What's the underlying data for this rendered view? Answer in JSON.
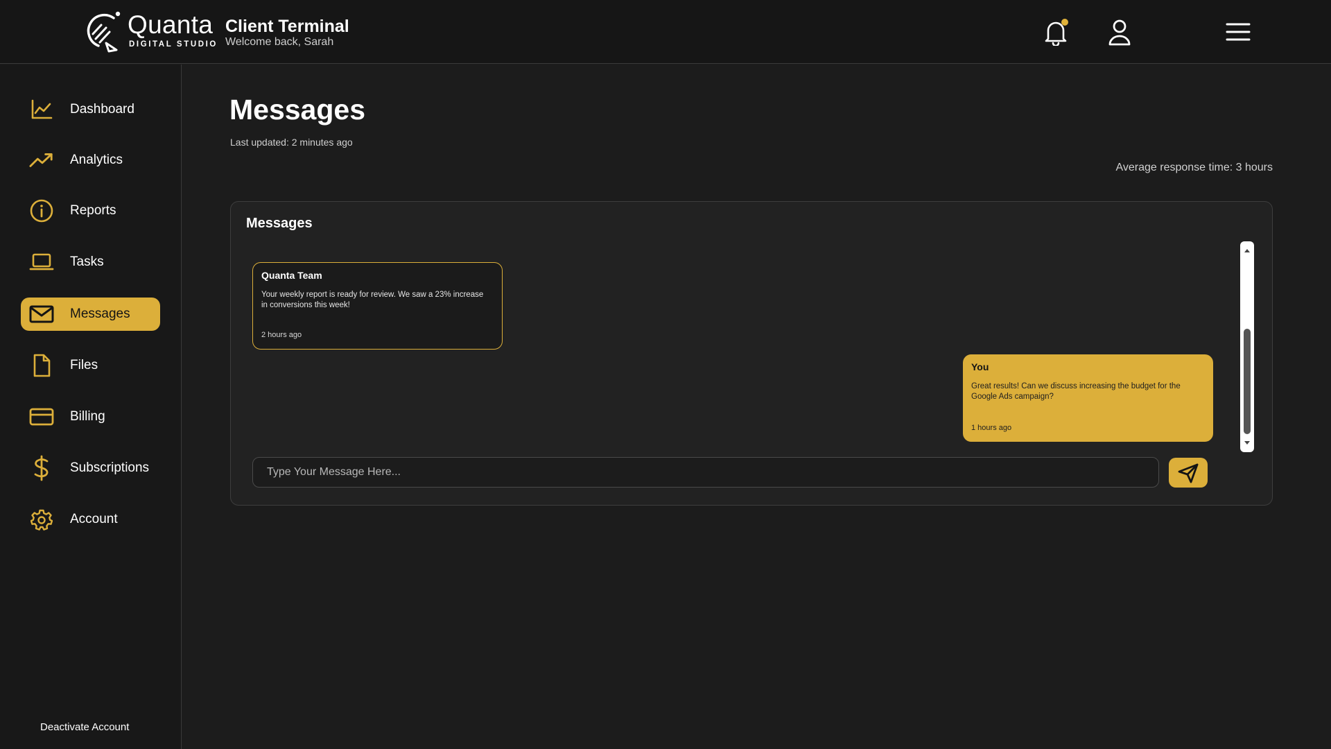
{
  "brand": {
    "name": "Quanta",
    "subtitle": "DIGITAL STUDIO",
    "accent_color": "#dcaf3a"
  },
  "header": {
    "title": "Client Terminal",
    "welcome": "Welcome back, Sarah",
    "icons": [
      "bell-icon",
      "user-icon",
      "hamburger-menu-icon"
    ],
    "has_unread_notification": true
  },
  "sidebar": {
    "items": [
      {
        "label": "Dashboard",
        "icon": "line-chart-icon"
      },
      {
        "label": "Analytics",
        "icon": "trending-up-icon"
      },
      {
        "label": "Reports",
        "icon": "info-circle-icon"
      },
      {
        "label": "Tasks",
        "icon": "laptop-icon"
      },
      {
        "label": "Messages",
        "icon": "mail-icon",
        "active": true
      },
      {
        "label": "Files",
        "icon": "file-icon"
      },
      {
        "label": "Billing",
        "icon": "credit-card-icon"
      },
      {
        "label": "Subscriptions",
        "icon": "dollar-icon"
      },
      {
        "label": "Account",
        "icon": "gear-icon"
      }
    ],
    "deactivate_label": "Deactivate Account"
  },
  "main": {
    "page_title": "Messages",
    "last_updated": "Last updated: 2 minutes ago",
    "avg_response": "Average response time: 3 hours",
    "panel": {
      "title": "Messages",
      "messages": [
        {
          "sender": "Quanta Team",
          "text": "Your weekly report is ready for review. We saw a 23% increase in conversions this week!",
          "time": "2 hours ago",
          "direction": "incoming"
        },
        {
          "sender": "You",
          "text": "Great results! Can we discuss increasing the budget for the Google Ads campaign?",
          "time": "1 hours ago",
          "direction": "outgoing"
        }
      ],
      "input_placeholder": "Type Your Message Here...",
      "input_value": "",
      "send_icon": "send-icon"
    }
  }
}
